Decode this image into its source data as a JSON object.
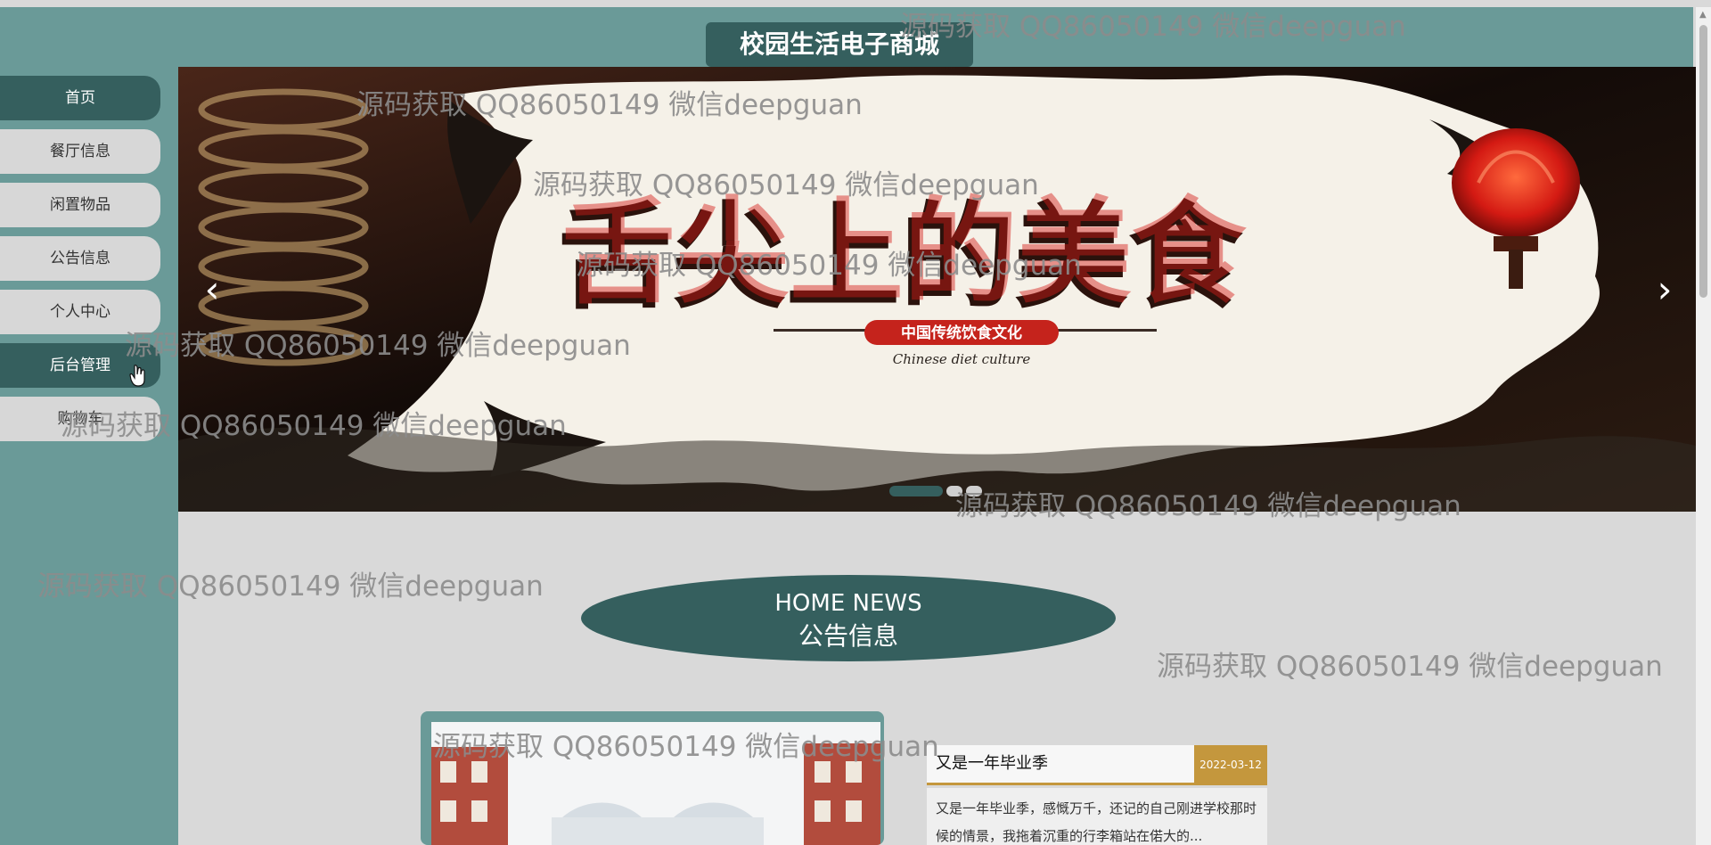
{
  "site": {
    "title": "校园生活电子商城"
  },
  "nav": {
    "items": [
      {
        "label": "首页",
        "active": true
      },
      {
        "label": "餐厅信息",
        "active": false
      },
      {
        "label": "闲置物品",
        "active": false
      },
      {
        "label": "公告信息",
        "active": false
      },
      {
        "label": "个人中心",
        "active": false
      },
      {
        "label": "后台管理",
        "active": true
      },
      {
        "label": "购物车",
        "active": false
      }
    ]
  },
  "banner": {
    "headline": "舌尖上的美食",
    "badge_text": "中国传统饮食文化",
    "subtitle": "Chinese diet culture",
    "prev_icon": "chevron-left-icon",
    "next_icon": "chevron-right-icon",
    "prev_glyph": "‹",
    "next_glyph": "›"
  },
  "news_section": {
    "english_title": "HOME NEWS",
    "chinese_title": "公告信息"
  },
  "notice": {
    "title": "又是一年毕业季",
    "date": "2022-03-12",
    "body": "又是一年毕业季，感慨万千，还记的自己刚进学校那时候的情景，我拖着沉重的行李箱站在偌大的..."
  },
  "watermark": {
    "text": "源码获取 QQ86050149 微信deepguan"
  },
  "colors": {
    "teal": "#6a9a98",
    "dark_teal": "#355f5e",
    "gold": "#c4973d",
    "background": "#d9d9d9"
  }
}
